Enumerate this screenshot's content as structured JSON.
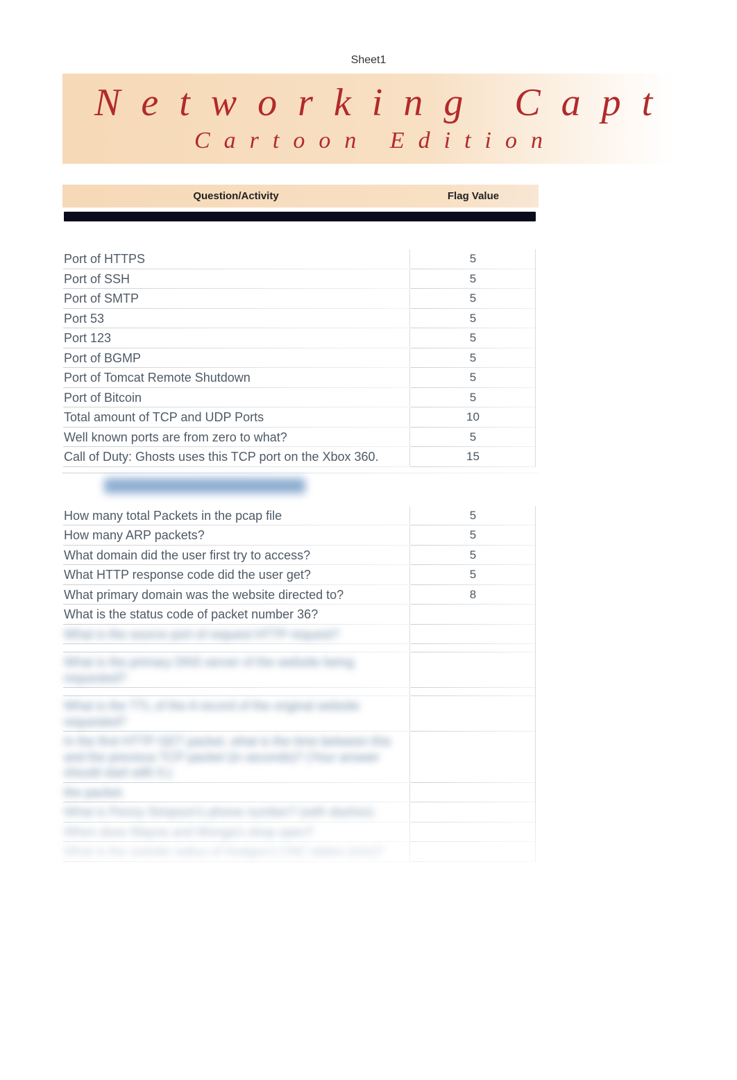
{
  "sheet_label": "Sheet1",
  "banner": {
    "title": "Networking Capture",
    "subtitle": "Cartoon Edition"
  },
  "headers": {
    "question": "Question/Activity",
    "flag_value": "Flag Value"
  },
  "section1": {
    "rows": [
      {
        "q": "Port of HTTPS",
        "v": "5"
      },
      {
        "q": "Port of SSH",
        "v": "5"
      },
      {
        "q": "Port of SMTP",
        "v": "5"
      },
      {
        "q": "Port 53",
        "v": "5"
      },
      {
        "q": "Port 123",
        "v": "5"
      },
      {
        "q": "Port of BGMP",
        "v": "5"
      },
      {
        "q": "Port of Tomcat Remote Shutdown",
        "v": "5"
      },
      {
        "q": "Port of Bitcoin",
        "v": "5"
      },
      {
        "q": "Total amount of TCP and UDP Ports",
        "v": "10"
      },
      {
        "q": "Well known ports are from zero to what?",
        "v": "5"
      },
      {
        "q": "Call of Duty: Ghosts uses this TCP port on the Xbox 360.",
        "v": "15"
      }
    ]
  },
  "section2": {
    "rows": [
      {
        "q": "How many total Packets in the pcap file",
        "v": "5"
      },
      {
        "q": "How many ARP packets?",
        "v": "5"
      },
      {
        "q": "What domain did the user first try to access?",
        "v": "5"
      },
      {
        "q": "What HTTP response code did the user get?",
        "v": "5"
      },
      {
        "q": "What primary domain was the website directed to?",
        "v": "8"
      },
      {
        "q": "What is the status code of packet number 36?",
        "v": ""
      }
    ]
  }
}
